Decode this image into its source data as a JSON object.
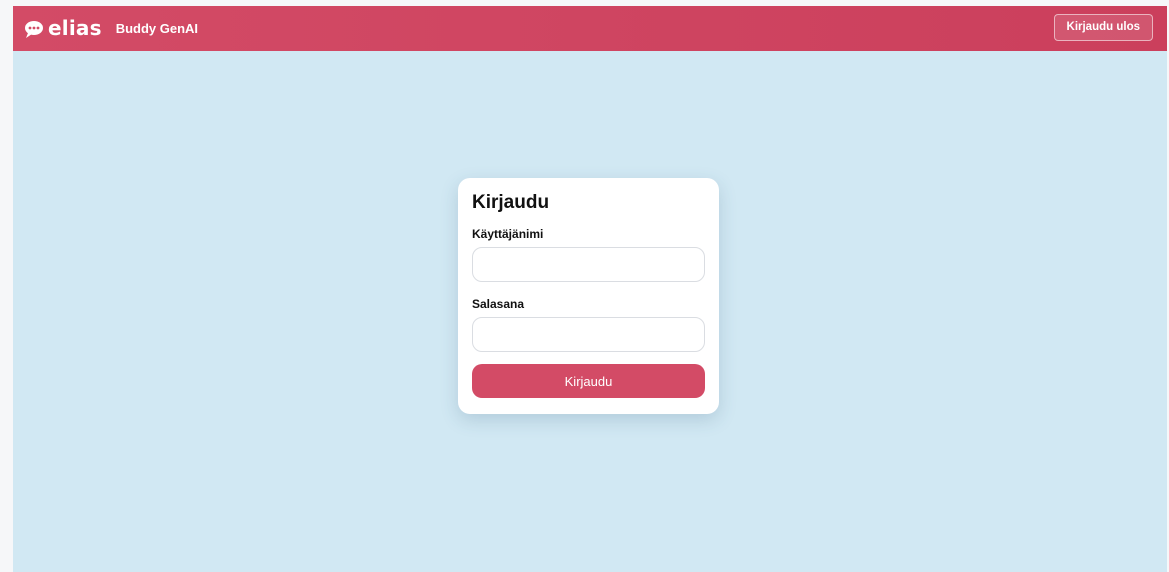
{
  "header": {
    "brand_name": "elias",
    "app_title": "Buddy GenAI",
    "logout_label": "Kirjaudu ulos",
    "logo_icon": "speech-bubble-icon"
  },
  "login": {
    "title": "Kirjaudu",
    "username_label": "Käyttäjänimi",
    "username_value": "",
    "password_label": "Salasana",
    "password_value": "",
    "submit_label": "Kirjaudu"
  },
  "colors": {
    "brand": "#d34b66",
    "background": "#d1e8f3",
    "card": "#ffffff"
  }
}
